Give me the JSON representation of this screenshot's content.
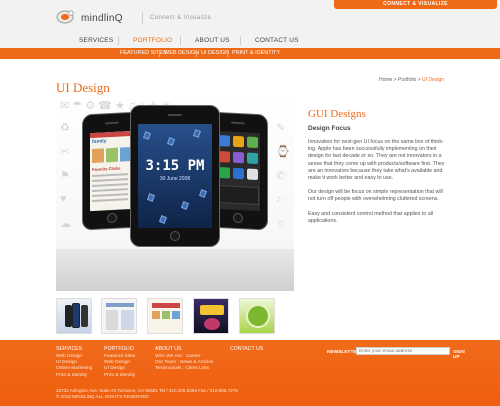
{
  "header": {
    "brand": "mindlinQ",
    "tagline": "Connect & Visualize",
    "cta": "CONNECT & VISUALIZE"
  },
  "nav": {
    "items": [
      {
        "label": "SERVICES"
      },
      {
        "label": "PORTFOLIO"
      },
      {
        "label": "ABOUT US"
      },
      {
        "label": "CONTACT US"
      }
    ],
    "active": "PORTFOLIO"
  },
  "subnav": {
    "items": [
      {
        "label": "FEATURED SITES"
      },
      {
        "label": "WEB DESIGN"
      },
      {
        "label": "UI DESIGN"
      },
      {
        "label": "PRINT & IDENTITY"
      }
    ]
  },
  "page": {
    "title": "UI Design",
    "breadcrumb": {
      "home": "Home",
      "sep1": " > ",
      "section": "Portfolio",
      "sep2": " > ",
      "current": "UI Design"
    }
  },
  "hero": {
    "clock": "3:15 PM",
    "date": "30 June 2008",
    "left_screen_brand": "family",
    "left_screen_tab": "Favorite Clicks"
  },
  "content": {
    "section_title": "GUI Designs",
    "subtitle": "Design Focus",
    "paragraphs": [
      "Innovation for next-gen UI focus on the same line of think-ing. Apple has been successfully implementing on their design for last decade or so. They are not innovators in a sense that they come up with products/software first. They are an innovators because they take what's available and make it work better and easy to use.",
      "Our design will be focus on simple representation that will not turn off people with overwhelming cluttered screens.",
      "Easy and consistent control method that applies to all applications."
    ]
  },
  "footer": {
    "columns": [
      {
        "head": "SERVICES",
        "links": [
          "Web Design",
          "UI Design",
          "Online Marketing",
          "Print & Identity"
        ]
      },
      {
        "head": "PORTFOLIO",
        "links": [
          "Featured Sites",
          "Web Design",
          "UI Design",
          "Print & Identity"
        ]
      },
      {
        "head": "ABOUT US",
        "links": [
          "Who We Are : Career",
          "Our Team : News & Articles",
          "Testimonials : Client Lists"
        ]
      },
      {
        "head": "CONTACT US",
        "links": []
      }
    ],
    "newsletter": {
      "label": "NEWSLETTER",
      "placeholder": "Enter your email address",
      "button": "SIGN UP"
    },
    "address": "23732 Arlington Ave. Suite #2 Torrance, CA 90501 Tel / 310.326.8294 Fax / 310.665.7276",
    "copyright": "© 2010 MINDLINQ ALL RIGHTS RESERVED"
  },
  "colors": {
    "accent": "#ef6a17"
  }
}
